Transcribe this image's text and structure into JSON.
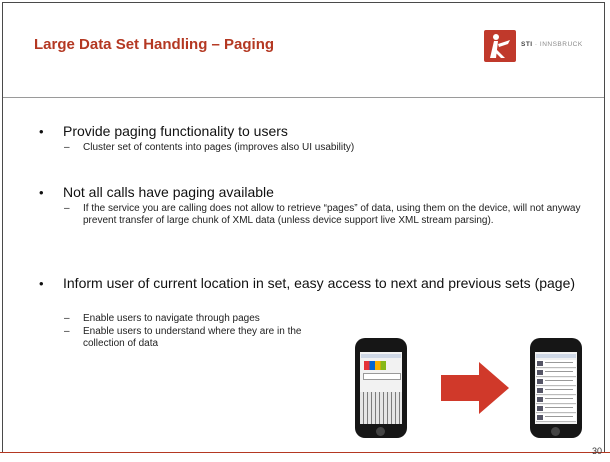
{
  "slide": {
    "title": "Large Data Set Handling – Paging",
    "logo": {
      "brand": "STI",
      "separator": " · ",
      "name": "INNSBRUCK",
      "color": "#c0392b"
    },
    "bullets": [
      {
        "text": "Provide paging functionality to users",
        "subs": [
          "Cluster set of contents into pages (improves also UI usability)"
        ]
      },
      {
        "text": "Not all calls have paging available",
        "subs": [
          "If the service you are calling does not allow to retrieve “pages” of data, using them on the device, will not anyway prevent transfer of large chunk of XML data (unless device support live XML stream parsing)."
        ]
      },
      {
        "text": "Inform user of current location in set, easy access to next and previous sets (page)",
        "subs": [
          "Enable users to navigate through pages",
          "Enable users to understand where they are in the collection of data"
        ]
      }
    ],
    "page_number": "30",
    "colors": {
      "title": "#b43822",
      "arrow": "#d0392a",
      "footer_rule": "#b43822"
    }
  }
}
